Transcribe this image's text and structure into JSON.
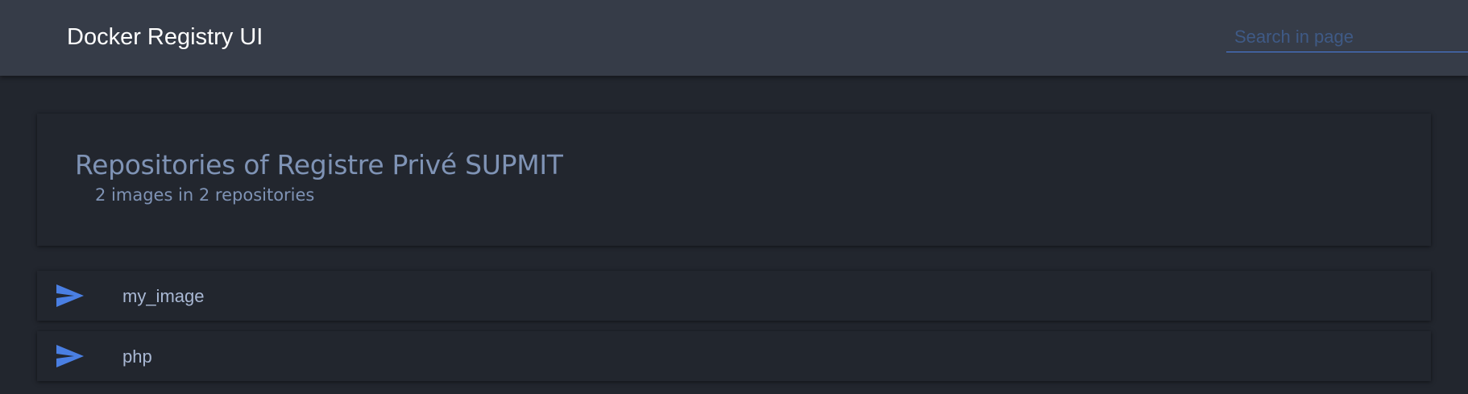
{
  "header": {
    "title": "Docker Registry UI",
    "search_placeholder": "Search in page",
    "search_value": ""
  },
  "page": {
    "title": "Repositories of Registre Privé SUPMIT",
    "subtitle": "2 images in 2 repositories"
  },
  "repositories": [
    {
      "name": "my_image",
      "icon": "send-icon"
    },
    {
      "name": "php",
      "icon": "send-icon"
    }
  ],
  "colors": {
    "background": "#22262e",
    "topbar": "#363c48",
    "accent": "#4a7fe3",
    "title_text": "#7f93b5",
    "item_text": "#a9b8d4"
  }
}
